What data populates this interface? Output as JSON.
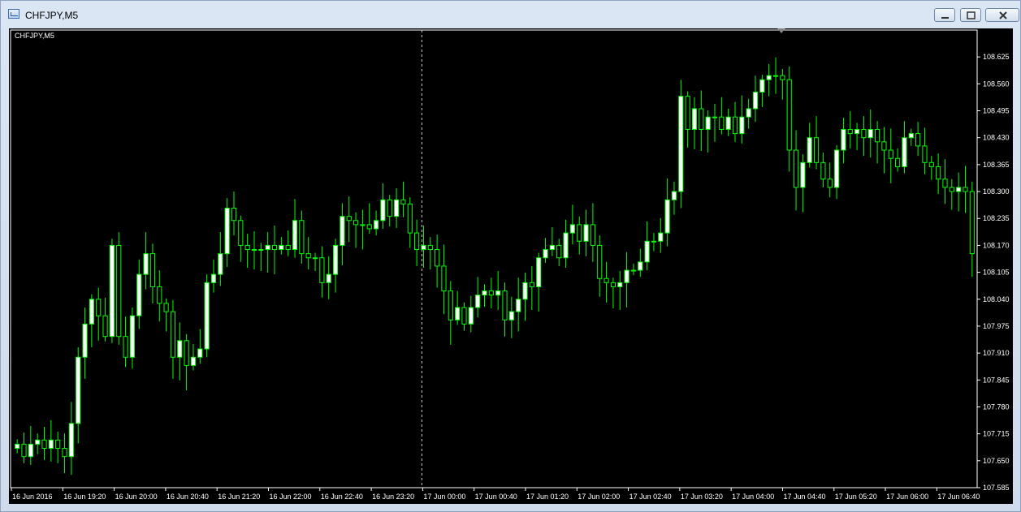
{
  "window": {
    "title": "CHFJPY,M5"
  },
  "chart_label": "CHFJPY,M5",
  "chart_data": {
    "type": "candlestick",
    "symbol": "CHFJPY",
    "timeframe": "M5",
    "ylim": [
      107.585,
      108.69
    ],
    "y_ticks": [
      "108.625",
      "108.560",
      "108.495",
      "108.430",
      "108.365",
      "108.300",
      "108.235",
      "108.170",
      "108.105",
      "108.040",
      "107.975",
      "107.910",
      "107.845",
      "107.780",
      "107.715",
      "107.650",
      "107.585"
    ],
    "x_ticks": [
      "16 Jun 2016",
      "16 Jun 19:20",
      "16 Jun 20:00",
      "16 Jun 20:40",
      "16 Jun 21:20",
      "16 Jun 22:00",
      "16 Jun 22:40",
      "16 Jun 23:20",
      "17 Jun 00:00",
      "17 Jun 00:40",
      "17 Jun 01:20",
      "17 Jun 02:00",
      "17 Jun 02:40",
      "17 Jun 03:20",
      "17 Jun 04:00",
      "17 Jun 04:40",
      "17 Jun 05:20",
      "17 Jun 06:00",
      "17 Jun 06:40"
    ],
    "candle_color": "#00ff00",
    "bull_fill": "#ffffff",
    "bear_fill": "#000000",
    "closes": [
      107.69,
      107.66,
      107.69,
      107.7,
      107.68,
      107.7,
      107.68,
      107.66,
      107.74,
      107.9,
      107.98,
      108.04,
      108.0,
      107.95,
      108.17,
      107.95,
      107.9,
      108.0,
      108.1,
      108.15,
      108.07,
      108.03,
      108.01,
      107.9,
      107.94,
      107.88,
      107.9,
      107.92,
      108.08,
      108.1,
      108.15,
      108.26,
      108.23,
      108.17,
      108.16,
      108.16,
      108.16,
      108.17,
      108.16,
      108.17,
      108.16,
      108.23,
      108.15,
      108.14,
      108.14,
      108.08,
      108.1,
      108.17,
      108.24,
      108.23,
      108.22,
      108.22,
      108.21,
      108.23,
      108.28,
      108.24,
      108.28,
      108.27,
      108.2,
      108.16,
      108.17,
      108.16,
      108.12,
      108.06,
      107.99,
      108.02,
      107.98,
      108.02,
      108.05,
      108.06,
      108.05,
      108.06,
      107.99,
      108.01,
      108.04,
      108.08,
      108.07,
      108.14,
      108.16,
      108.17,
      108.14,
      108.2,
      108.22,
      108.18,
      108.22,
      108.17,
      108.09,
      108.08,
      108.07,
      108.08,
      108.11,
      108.11,
      108.13,
      108.18,
      108.18,
      108.2,
      108.28,
      108.3,
      108.53,
      108.45,
      108.5,
      108.45,
      108.48,
      108.48,
      108.45,
      108.48,
      108.44,
      108.48,
      108.5,
      108.54,
      108.57,
      108.58,
      108.58,
      108.57,
      108.4,
      108.31,
      108.37,
      108.43,
      108.37,
      108.33,
      108.31,
      108.4,
      108.45,
      108.44,
      108.45,
      108.43,
      108.45,
      108.42,
      108.4,
      108.38,
      108.36,
      108.43,
      108.44,
      108.41,
      108.37,
      108.36,
      108.33,
      108.31,
      108.3,
      108.31,
      108.3,
      108.15
    ],
    "open_price": 107.68
  }
}
